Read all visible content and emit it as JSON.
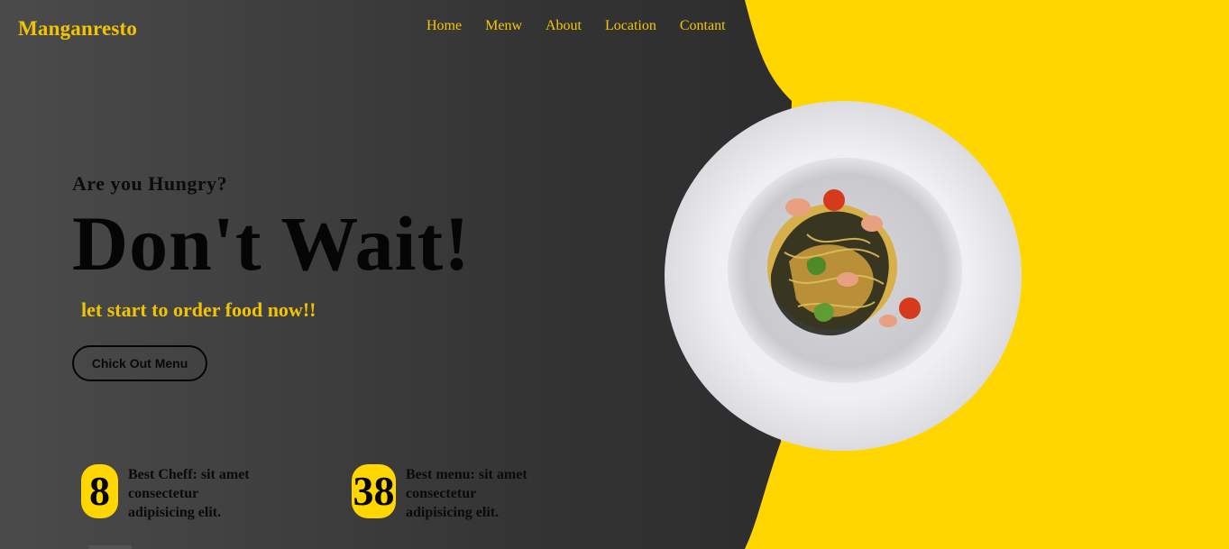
{
  "brand": {
    "name": "Manganresto"
  },
  "nav": {
    "items": [
      "Home",
      "Menw",
      "About",
      "Location",
      "Contant"
    ]
  },
  "hero": {
    "eyebrow": "Are you Hungry?",
    "headline": "Don't Wait!",
    "subline": "let start to order food now!!",
    "cta_label": "Chick Out Menu"
  },
  "stats": [
    {
      "number": "8",
      "text": "Best Cheff: sit amet consectetur adipisicing elit."
    },
    {
      "number": "38",
      "text": "Best menu: sit amet consectetur adipisicing elit."
    }
  ],
  "colors": {
    "accent": "#ffd600",
    "text_accent": "#f2c400",
    "dark": "#2e2e2f"
  },
  "icons": {
    "plate": "pasta-dish-image"
  }
}
